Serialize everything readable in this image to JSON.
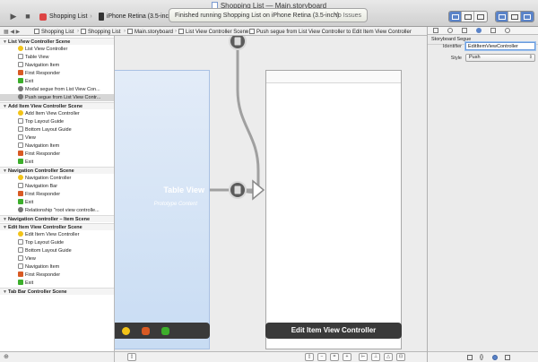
{
  "window": {
    "title": "Shopping List — Main.storyboard"
  },
  "toolbar": {
    "run_icon": "▶",
    "stop_icon": "■",
    "scheme_name": "Shopping List",
    "device_name": "iPhone Retina (3.5-inch)",
    "status_message": "Finished running Shopping List on iPhone Retina (3.5-inch)",
    "status_issues": "No Issues"
  },
  "jumpbar": {
    "items": [
      "Shopping List",
      "Shopping List",
      "Main.storyboard",
      "List View Controller Scene",
      "Push segue from List View Controller to Edit Item View Controller"
    ]
  },
  "outline": {
    "rows": [
      {
        "label": "List View Controller Scene",
        "kind": "scene",
        "icon": ""
      },
      {
        "label": "List View Controller",
        "kind": "item",
        "icon": "yellow"
      },
      {
        "label": "Table View",
        "kind": "item",
        "icon": "white"
      },
      {
        "label": "Navigation Item",
        "kind": "item",
        "icon": "white"
      },
      {
        "label": "First Responder",
        "kind": "item",
        "icon": "red"
      },
      {
        "label": "Exit",
        "kind": "item",
        "icon": "green"
      },
      {
        "label": "Modal segue from List View Con...",
        "kind": "item",
        "icon": "gray"
      },
      {
        "label": "Push segue from List View Contr...",
        "kind": "item",
        "icon": "gray"
      },
      {
        "label": "Add Item View Controller Scene",
        "kind": "scene",
        "icon": ""
      },
      {
        "label": "Add Item View Controller",
        "kind": "item",
        "icon": "yellow"
      },
      {
        "label": "Top Layout Guide",
        "kind": "item",
        "icon": "white"
      },
      {
        "label": "Bottom Layout Guide",
        "kind": "item",
        "icon": "white"
      },
      {
        "label": "View",
        "kind": "item",
        "icon": "white"
      },
      {
        "label": "Navigation Item",
        "kind": "item",
        "icon": "white"
      },
      {
        "label": "First Responder",
        "kind": "item",
        "icon": "red"
      },
      {
        "label": "Exit",
        "kind": "item",
        "icon": "green"
      },
      {
        "label": "Navigation Controller Scene",
        "kind": "scene",
        "icon": ""
      },
      {
        "label": "Navigation Controller",
        "kind": "item",
        "icon": "yellow"
      },
      {
        "label": "Navigation Bar",
        "kind": "item",
        "icon": "white"
      },
      {
        "label": "First Responder",
        "kind": "item",
        "icon": "red"
      },
      {
        "label": "Exit",
        "kind": "item",
        "icon": "green"
      },
      {
        "label": "Relationship \"root view controlle...",
        "kind": "item",
        "icon": "gray"
      },
      {
        "label": "Navigation Controller – Item Scene",
        "kind": "scene",
        "icon": ""
      },
      {
        "label": "Edit Item View Controller Scene",
        "kind": "scene",
        "icon": ""
      },
      {
        "label": "Edit Item View Controller",
        "kind": "item",
        "icon": "yellow"
      },
      {
        "label": "Top Layout Guide",
        "kind": "item",
        "icon": "white"
      },
      {
        "label": "Bottom Layout Guide",
        "kind": "item",
        "icon": "white"
      },
      {
        "label": "View",
        "kind": "item",
        "icon": "white"
      },
      {
        "label": "Navigation Item",
        "kind": "item",
        "icon": "white"
      },
      {
        "label": "First Responder",
        "kind": "item",
        "icon": "red"
      },
      {
        "label": "Exit",
        "kind": "item",
        "icon": "green"
      },
      {
        "label": "Tab Bar Controller Scene",
        "kind": "scene",
        "icon": ""
      }
    ],
    "selected_index": 7
  },
  "canvas": {
    "table_view_title": "Table View",
    "table_view_subtitle": "Prototype Content",
    "edit_vc_title": "Edit Item View Controller"
  },
  "inspector": {
    "section_title": "Storyboard Segue",
    "identifier_label": "Identifier",
    "identifier_value": "EditItemViewController",
    "style_label": "Style",
    "style_value": "Push"
  },
  "colors": {
    "selection": "#d6d6d6",
    "accent_blue": "#5a83c8",
    "scene_bar": "#3a3a3a"
  }
}
